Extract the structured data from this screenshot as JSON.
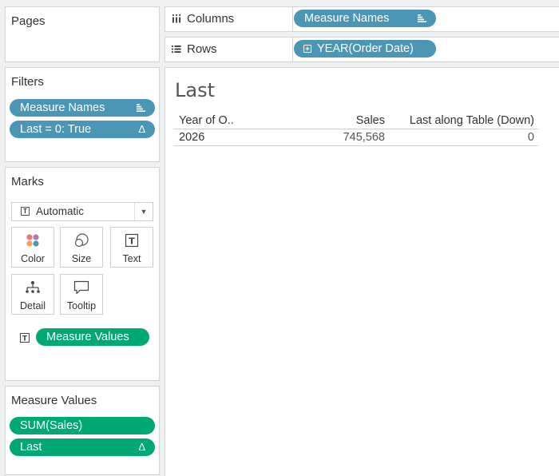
{
  "pages_panel": {
    "title": "Pages"
  },
  "filters_panel": {
    "title": "Filters",
    "pills": [
      {
        "label": "Measure Names",
        "icon": "list-sort-icon"
      },
      {
        "label": "Last = 0: True",
        "icon": "delta-icon"
      }
    ]
  },
  "marks_panel": {
    "title": "Marks",
    "mark_type": "Automatic",
    "buttons": [
      "Color",
      "Size",
      "Text",
      "Detail",
      "Tooltip"
    ],
    "text_pill": "Measure Values"
  },
  "measure_values_panel": {
    "title": "Measure Values",
    "pills": [
      {
        "label": "SUM(Sales)"
      },
      {
        "label": "Last",
        "icon": "delta-icon"
      }
    ]
  },
  "shelves": {
    "columns": {
      "label": "Columns",
      "pill": "Measure Names"
    },
    "rows": {
      "label": "Rows",
      "pill": "YEAR(Order Date)"
    }
  },
  "view": {
    "title": "Last",
    "table": {
      "headers": [
        "Year of O..",
        "Sales",
        "Last along Table (Down)"
      ],
      "rows": [
        [
          "2026",
          "745,568",
          "0"
        ]
      ]
    }
  },
  "colors": {
    "blue_pill": "#4b96b4",
    "green_pill": "#00a873",
    "background": "#eef0f2"
  }
}
